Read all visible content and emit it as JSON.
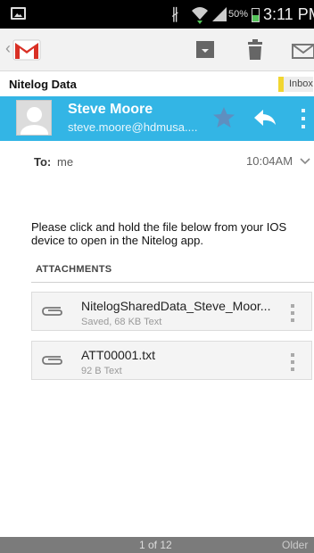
{
  "status_bar": {
    "battery_percent": "50%",
    "battery_level": 0.5,
    "time": "3:11 PM",
    "icons": [
      "image-notification-icon",
      "bluetooth-icon",
      "wifi-icon",
      "signal-icon",
      "battery-icon"
    ]
  },
  "toolbar": {
    "back_icon": "chevron-left-icon",
    "app_icon": "gmail-icon",
    "actions": [
      "archive-icon",
      "delete-icon",
      "mark-unread-icon"
    ]
  },
  "message": {
    "subject": "Nitelog Data",
    "label": "Inbox",
    "label_color": "#f1d631",
    "sender_name": "Steve Moore",
    "sender_email": "steve.moore@hdmusa....",
    "sender_bar_color": "#33b5e5",
    "to_label": "To:",
    "to_value": "me",
    "time": "10:04AM",
    "body": "Please click and hold the file below from your IOS device to open in the Nitelog app."
  },
  "attachments": {
    "header": "ATTACHMENTS",
    "items": [
      {
        "name": "NitelogSharedData_Steve_Moor...",
        "meta": "Saved, 68 KB Text"
      },
      {
        "name": "ATT00001.txt",
        "meta": "92 B Text"
      }
    ]
  },
  "footer": {
    "pager": "1 of 12",
    "older_label": "Older"
  }
}
